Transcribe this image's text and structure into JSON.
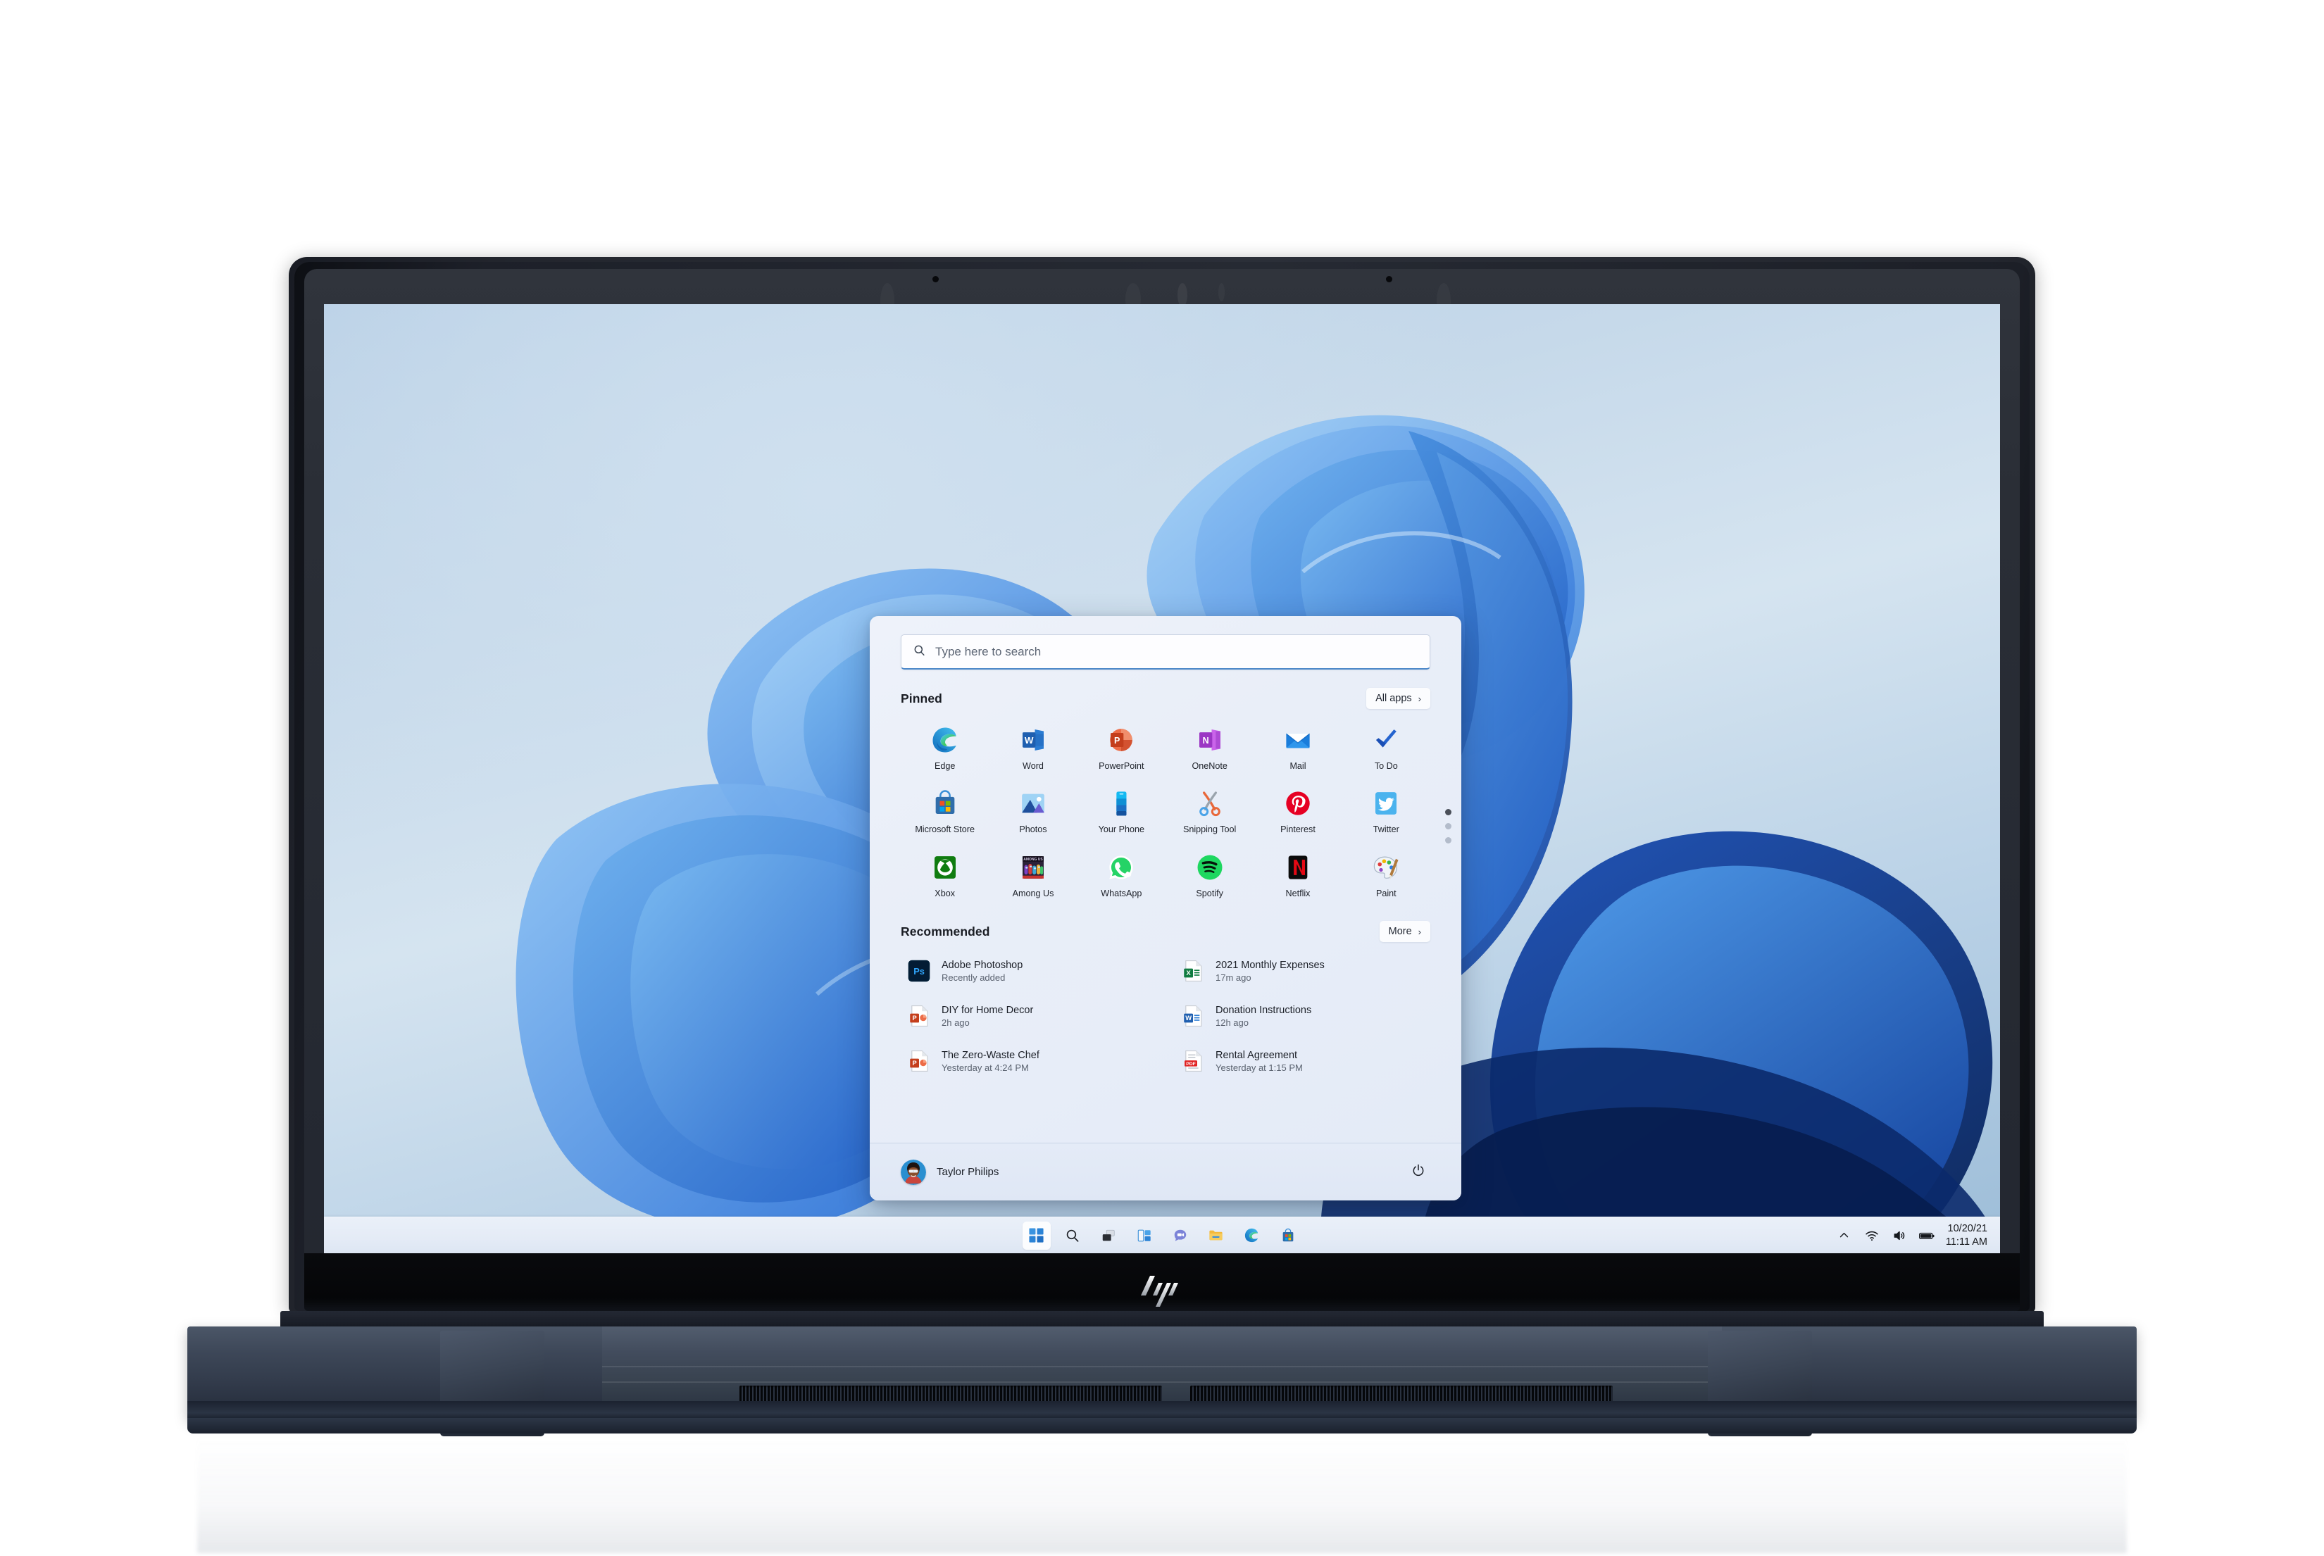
{
  "device": {
    "brand_logo": "hp-logo",
    "chassis_color": "#3a4454"
  },
  "desktop": {
    "wallpaper_name": "Windows 11 Bloom"
  },
  "start_menu": {
    "search": {
      "placeholder": "Type here to search",
      "icon": "search-icon"
    },
    "pinned": {
      "title": "Pinned",
      "all_apps_label": "All apps",
      "chevron": "›",
      "pages": 3,
      "active_page": 1,
      "apps": [
        {
          "label": "Edge",
          "icon": "edge-icon"
        },
        {
          "label": "Word",
          "icon": "word-icon"
        },
        {
          "label": "PowerPoint",
          "icon": "powerpoint-icon"
        },
        {
          "label": "OneNote",
          "icon": "onenote-icon"
        },
        {
          "label": "Mail",
          "icon": "mail-icon"
        },
        {
          "label": "To Do",
          "icon": "todo-icon"
        },
        {
          "label": "Microsoft Store",
          "icon": "microsoft-store-icon"
        },
        {
          "label": "Photos",
          "icon": "photos-icon"
        },
        {
          "label": "Your Phone",
          "icon": "your-phone-icon"
        },
        {
          "label": "Snipping Tool",
          "icon": "snipping-tool-icon"
        },
        {
          "label": "Pinterest",
          "icon": "pinterest-icon"
        },
        {
          "label": "Twitter",
          "icon": "twitter-icon"
        },
        {
          "label": "Xbox",
          "icon": "xbox-icon"
        },
        {
          "label": "Among Us",
          "icon": "among-us-icon"
        },
        {
          "label": "WhatsApp",
          "icon": "whatsapp-icon"
        },
        {
          "label": "Spotify",
          "icon": "spotify-icon"
        },
        {
          "label": "Netflix",
          "icon": "netflix-icon"
        },
        {
          "label": "Paint",
          "icon": "paint-icon"
        }
      ]
    },
    "recommended": {
      "title": "Recommended",
      "more_label": "More",
      "chevron": "›",
      "items": [
        {
          "name": "Adobe Photoshop",
          "meta": "Recently added",
          "icon": "photoshop-icon"
        },
        {
          "name": "2021 Monthly Expenses",
          "meta": "17m ago",
          "icon": "excel-file-icon"
        },
        {
          "name": "DIY for Home Decor",
          "meta": "2h ago",
          "icon": "powerpoint-file-icon"
        },
        {
          "name": "Donation Instructions",
          "meta": "12h ago",
          "icon": "word-file-icon"
        },
        {
          "name": "The Zero-Waste Chef",
          "meta": "Yesterday at 4:24 PM",
          "icon": "powerpoint-file-icon"
        },
        {
          "name": "Rental Agreement",
          "meta": "Yesterday at 1:15 PM",
          "icon": "pdf-file-icon"
        }
      ]
    },
    "footer": {
      "user_name": "Taylor Philips",
      "avatar": "user-avatar",
      "power_icon": "power-icon"
    }
  },
  "taskbar": {
    "buttons": [
      {
        "name": "start-button",
        "icon": "windows-logo-icon",
        "active": true
      },
      {
        "name": "search-button",
        "icon": "search-icon",
        "active": false
      },
      {
        "name": "task-view-button",
        "icon": "task-view-icon",
        "active": false
      },
      {
        "name": "widgets-button",
        "icon": "widgets-icon",
        "active": false
      },
      {
        "name": "chat-button",
        "icon": "teams-chat-icon",
        "active": false
      },
      {
        "name": "file-explorer-button",
        "icon": "folder-icon",
        "active": false
      },
      {
        "name": "edge-button",
        "icon": "edge-icon",
        "active": false
      },
      {
        "name": "store-button",
        "icon": "microsoft-store-icon",
        "active": false
      }
    ],
    "tray": {
      "overflow_icon": "chevron-up-icon",
      "wifi_icon": "wifi-icon",
      "volume_icon": "speaker-icon",
      "battery_icon": "battery-icon",
      "date": "10/20/21",
      "time": "11:11 AM"
    }
  },
  "colors": {
    "accent": "#0078d4",
    "taskbar_bg": "#e6edf7",
    "start_bg": "#e9eef8"
  }
}
